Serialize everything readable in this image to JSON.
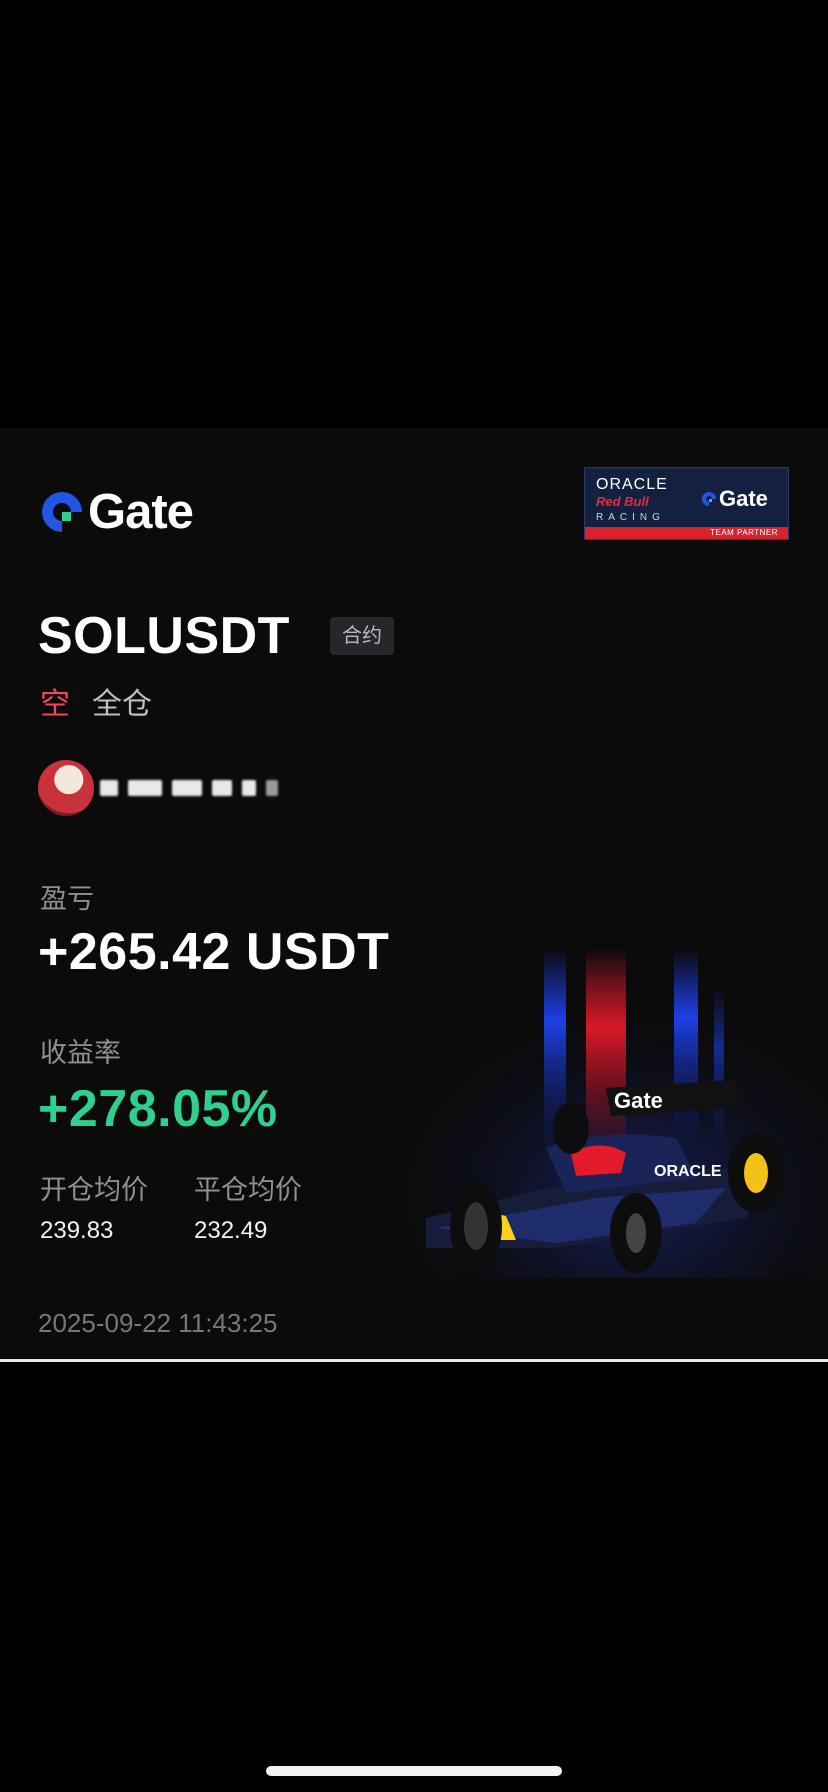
{
  "brand": {
    "name": "Gate",
    "color_primary": "#2354e6",
    "color_accent": "#2fcf8e"
  },
  "partner_badge": {
    "line1": "ORACLE",
    "line2": "Red Bull",
    "line3": "RACING",
    "brand": "Gate",
    "footer": "TEAM PARTNER"
  },
  "position": {
    "symbol": "SOLUSDT",
    "type_tag": "合约",
    "side": "空",
    "margin_mode": "全仓",
    "side_color": "#f0455e"
  },
  "user": {
    "avatar": "user-avatar"
  },
  "stats": {
    "pnl_label": "盈亏",
    "pnl_value": "+265.42 USDT",
    "roi_label": "收益率",
    "roi_value": "+278.05%",
    "open_price_label": "开仓均价",
    "open_price_value": "239.83",
    "close_price_label": "平仓均价",
    "close_price_value": "232.49"
  },
  "timestamp": "2025-09-22 11:43:25",
  "car_livery": {
    "wing_text": "Gate",
    "sidepod_text": "ORACLE"
  }
}
